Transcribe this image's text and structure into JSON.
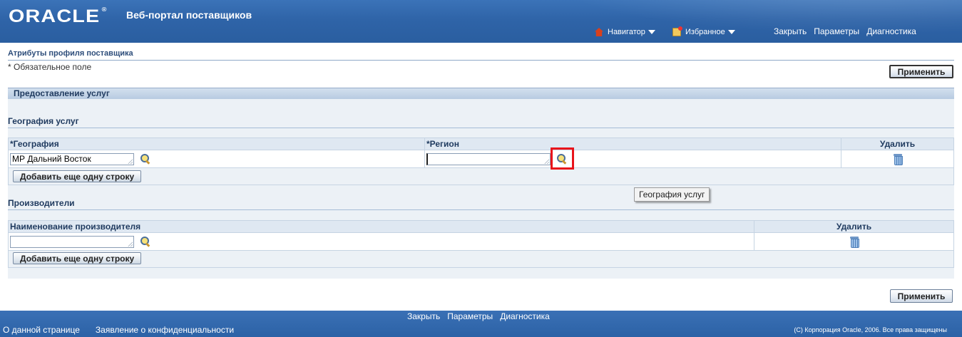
{
  "header": {
    "brand": "ORACLE",
    "app_title": "Веб-портал поставщиков",
    "navigator_label": "Навигатор",
    "favorites_label": "Избранное",
    "links": [
      "Закрыть",
      "Параметры",
      "Диагностика"
    ]
  },
  "page": {
    "title": "Атрибуты профиля поставщика",
    "required_note": "* Обязательное поле",
    "apply_label": "Применить"
  },
  "section": {
    "title": "Предоставление услуг",
    "geography": {
      "title": "География услуг",
      "columns": [
        "*География",
        "*Регион",
        "Удалить"
      ],
      "row": {
        "geography_value": "МР Дальний Восток",
        "region_value": ""
      },
      "add_row_label": "Добавить еще одну строку"
    },
    "manufacturers": {
      "title": "Производители",
      "columns": [
        "Наименование производителя",
        "Удалить"
      ],
      "row": {
        "name_value": ""
      },
      "add_row_label": "Добавить еще одну строку"
    }
  },
  "tooltip": "География услуг",
  "footer": {
    "links": [
      "Закрыть",
      "Параметры",
      "Диагностика"
    ],
    "about": "О данной странице",
    "privacy": "Заявление о конфиденциальности",
    "copyright": "(C) Корпорация Oracle, 2006. Все права защищены"
  }
}
